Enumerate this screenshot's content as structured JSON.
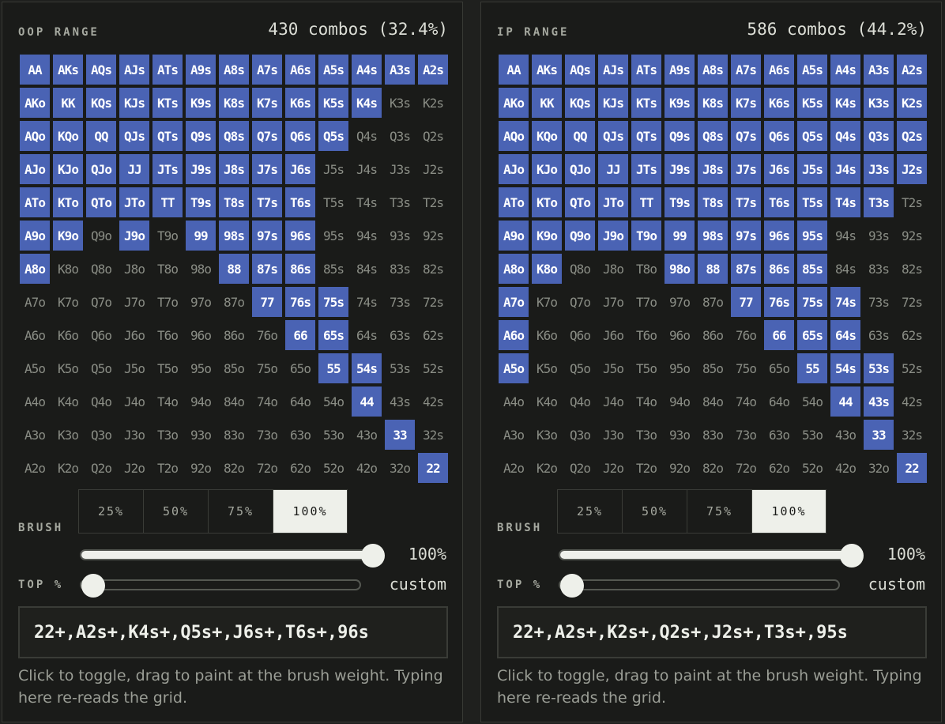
{
  "ranks": [
    "A",
    "K",
    "Q",
    "J",
    "T",
    "9",
    "8",
    "7",
    "6",
    "5",
    "4",
    "3",
    "2"
  ],
  "colors": {
    "selected": "#4a63b4",
    "unselected_text": "#8a8d85",
    "active_button": "#eef0ea"
  },
  "panels": [
    {
      "id": "oop",
      "title": "OOP RANGE",
      "combos_text": "430 combos (32.4%)",
      "selected": [
        "AA",
        "AKs",
        "AQs",
        "AJs",
        "ATs",
        "A9s",
        "A8s",
        "A7s",
        "A6s",
        "A5s",
        "A4s",
        "A3s",
        "A2s",
        "AKo",
        "KK",
        "KQs",
        "KJs",
        "KTs",
        "K9s",
        "K8s",
        "K7s",
        "K6s",
        "K5s",
        "K4s",
        "AQo",
        "KQo",
        "QQ",
        "QJs",
        "QTs",
        "Q9s",
        "Q8s",
        "Q7s",
        "Q6s",
        "Q5s",
        "AJo",
        "KJo",
        "QJo",
        "JJ",
        "JTs",
        "J9s",
        "J8s",
        "J7s",
        "J6s",
        "ATo",
        "KTo",
        "QTo",
        "JTo",
        "TT",
        "T9s",
        "T8s",
        "T7s",
        "T6s",
        "A9o",
        "K9o",
        "J9o",
        "99",
        "98s",
        "97s",
        "96s",
        "A8o",
        "88",
        "87s",
        "86s",
        "77",
        "76s",
        "75s",
        "66",
        "65s",
        "55",
        "54s",
        "44",
        "33",
        "22"
      ],
      "brush_label": "BRUSH",
      "brush_options": [
        "25%",
        "50%",
        "75%",
        "100%"
      ],
      "brush_active": "100%",
      "brush_value_text": "100%",
      "brush_fraction": 1.0,
      "top_label": "TOP %",
      "top_value_text": "custom",
      "top_fraction": 0.0,
      "range_text": "22+,A2s+,K4s+,Q5s+,J6s+,T6s+,96s",
      "help_text": "Click to toggle, drag to paint at the brush weight. Typing here re-reads the grid."
    },
    {
      "id": "ip",
      "title": "IP RANGE",
      "combos_text": "586 combos (44.2%)",
      "selected": [
        "AA",
        "AKs",
        "AQs",
        "AJs",
        "ATs",
        "A9s",
        "A8s",
        "A7s",
        "A6s",
        "A5s",
        "A4s",
        "A3s",
        "A2s",
        "AKo",
        "KK",
        "KQs",
        "KJs",
        "KTs",
        "K9s",
        "K8s",
        "K7s",
        "K6s",
        "K5s",
        "K4s",
        "K3s",
        "K2s",
        "AQo",
        "KQo",
        "QQ",
        "QJs",
        "QTs",
        "Q9s",
        "Q8s",
        "Q7s",
        "Q6s",
        "Q5s",
        "Q4s",
        "Q3s",
        "Q2s",
        "AJo",
        "KJo",
        "QJo",
        "JJ",
        "JTs",
        "J9s",
        "J8s",
        "J7s",
        "J6s",
        "J5s",
        "J4s",
        "J3s",
        "J2s",
        "ATo",
        "KTo",
        "QTo",
        "JTo",
        "TT",
        "T9s",
        "T8s",
        "T7s",
        "T6s",
        "T5s",
        "T4s",
        "T3s",
        "A9o",
        "K9o",
        "Q9o",
        "J9o",
        "T9o",
        "99",
        "98s",
        "97s",
        "96s",
        "95s",
        "A8o",
        "K8o",
        "98o",
        "88",
        "87s",
        "86s",
        "85s",
        "A7o",
        "77",
        "76s",
        "75s",
        "74s",
        "A6o",
        "66",
        "65s",
        "64s",
        "A5o",
        "55",
        "54s",
        "53s",
        "44",
        "43s",
        "33",
        "22"
      ],
      "brush_label": "BRUSH",
      "brush_options": [
        "25%",
        "50%",
        "75%",
        "100%"
      ],
      "brush_active": "100%",
      "brush_value_text": "100%",
      "brush_fraction": 1.0,
      "top_label": "TOP %",
      "top_value_text": "custom",
      "top_fraction": 0.0,
      "range_text": "22+,A2s+,K2s+,Q2s+,J2s+,T3s+,95s",
      "help_text": "Click to toggle, drag to paint at the brush weight. Typing here re-reads the grid."
    }
  ]
}
